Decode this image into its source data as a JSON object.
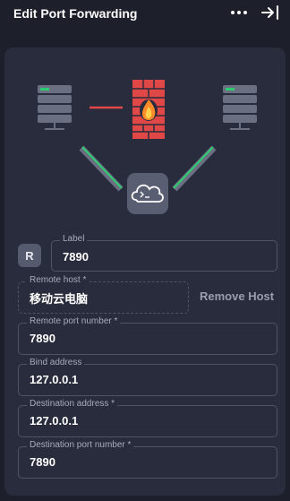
{
  "header": {
    "title": "Edit Port Forwarding"
  },
  "form": {
    "badge": "R",
    "label": {
      "label": "Label",
      "value": "7890"
    },
    "remote_host": {
      "label": "Remote host *",
      "value": "移动云电脑"
    },
    "remove_host_label": "Remove Host",
    "remote_port": {
      "label": "Remote port number *",
      "value": "7890"
    },
    "bind_address": {
      "label": "Bind address",
      "value": "127.0.0.1"
    },
    "destination_address": {
      "label": "Destination address *",
      "value": "127.0.0.1"
    },
    "destination_port": {
      "label": "Destination port number *",
      "value": "7890"
    }
  },
  "icons": {
    "more": "more-horizontal-icon",
    "collapse": "collapse-right-icon",
    "servers": "server-icon",
    "firewall": "firewall-icon",
    "terminal_cloud": "cloud-terminal-icon"
  },
  "colors": {
    "background": "#1d1f2b",
    "panel": "#292c3c",
    "firewall": "#e04848",
    "connector_green": "#2ecc71"
  }
}
